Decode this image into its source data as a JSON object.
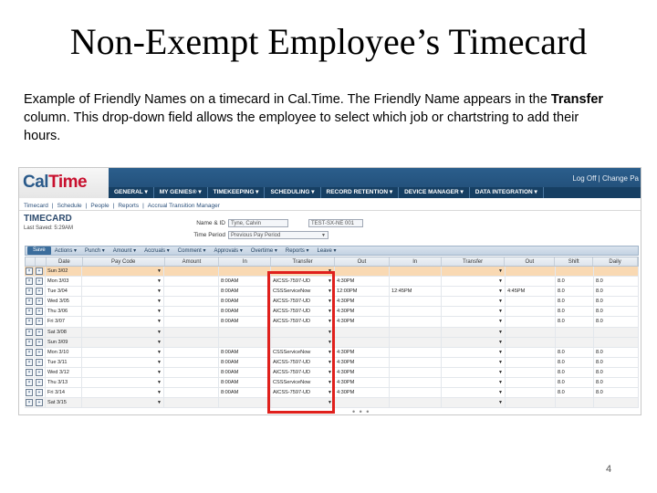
{
  "slide": {
    "title": "Non-Exempt Employee’s Timecard",
    "body_part1": "Example of Friendly Names on a timecard in Cal.Time.  The Friendly Name appears in the ",
    "body_bold": "Transfer",
    "body_part2": " column.  This drop-down field allows the employee to select which job or chartstring to add their hours.",
    "page_number": "4"
  },
  "app": {
    "logo_part1": "Cal",
    "logo_part2": "Time",
    "header_links": "Log Off | Change Pa",
    "nav": [
      "GENERAL ▾",
      "MY GENIES® ▾",
      "TIMEKEEPING ▾",
      "SCHEDULING ▾",
      "RECORD RETENTION ▾",
      "DEVICE MANAGER ▾",
      "DATA INTEGRATION ▾"
    ],
    "subnav": [
      "Timecard",
      "|",
      "Schedule",
      "|",
      "People",
      "|",
      "Reports",
      "|",
      "Accrual Transition Manager"
    ]
  },
  "timecard": {
    "title": "TIMECARD",
    "last_saved": "Last Saved: 5:29AM",
    "name_label": "Name & ID",
    "name_value": "Tyne, Calvin",
    "id_value": "TEST-SX-NE 001",
    "period_label": "Time Period",
    "period_value": "Previous Pay Period"
  },
  "toolbar": {
    "save": "Save",
    "items": [
      "Actions ▾",
      "Punch ▾",
      "Amount ▾",
      "Accruals ▾",
      "Comment ▾",
      "Approvals ▾",
      "Overtime ▾",
      "Reports ▾",
      "Leave ▾"
    ]
  },
  "grid": {
    "columns": [
      "",
      "",
      "Date",
      "Pay Code",
      "Amount",
      "In",
      "Transfer",
      "Out",
      "In",
      "Transfer",
      "Out",
      "Shift",
      "Daily"
    ],
    "rows": [
      {
        "date": "Sun 3/02",
        "in": "",
        "transfer": "",
        "out": "",
        "in2": "",
        "out2": "",
        "shift": "",
        "daily": "",
        "style": "selected"
      },
      {
        "date": "Mon 3/03",
        "in": "8:00AM",
        "transfer": "AICSS-7597-UD",
        "out": "4:30PM",
        "in2": "",
        "out2": "",
        "shift": "8.0",
        "daily": "8.0",
        "style": ""
      },
      {
        "date": "Tue 3/04",
        "in": "8:00AM",
        "transfer": "CSSServiceNow",
        "out": "12:00PM",
        "in2": "12:45PM",
        "out2": "4:45PM",
        "shift": "8.0",
        "daily": "8.0",
        "style": ""
      },
      {
        "date": "Wed 3/05",
        "in": "8:00AM",
        "transfer": "AICSS-7597-UD",
        "out": "4:30PM",
        "in2": "",
        "out2": "",
        "shift": "8.0",
        "daily": "8.0",
        "style": ""
      },
      {
        "date": "Thu 3/06",
        "in": "8:00AM",
        "transfer": "AICSS-7597-UD",
        "out": "4:30PM",
        "in2": "",
        "out2": "",
        "shift": "8.0",
        "daily": "8.0",
        "style": ""
      },
      {
        "date": "Fri 3/07",
        "in": "8:00AM",
        "transfer": "AICSS-7597-UD",
        "out": "4:30PM",
        "in2": "",
        "out2": "",
        "shift": "8.0",
        "daily": "8.0",
        "style": ""
      },
      {
        "date": "Sat 3/08",
        "in": "",
        "transfer": "",
        "out": "",
        "in2": "",
        "out2": "",
        "shift": "",
        "daily": "",
        "style": "weekend"
      },
      {
        "date": "Sun 3/09",
        "in": "",
        "transfer": "",
        "out": "",
        "in2": "",
        "out2": "",
        "shift": "",
        "daily": "",
        "style": "weekend"
      },
      {
        "date": "Mon 3/10",
        "in": "8:00AM",
        "transfer": "CSSServiceNow",
        "out": "4:30PM",
        "in2": "",
        "out2": "",
        "shift": "8.0",
        "daily": "8.0",
        "style": ""
      },
      {
        "date": "Tue 3/11",
        "in": "8:00AM",
        "transfer": "AICSS-7597-UD",
        "out": "4:30PM",
        "in2": "",
        "out2": "",
        "shift": "8.0",
        "daily": "8.0",
        "style": ""
      },
      {
        "date": "Wed 3/12",
        "in": "8:00AM",
        "transfer": "AICSS-7597-UD",
        "out": "4:30PM",
        "in2": "",
        "out2": "",
        "shift": "8.0",
        "daily": "8.0",
        "style": ""
      },
      {
        "date": "Thu 3/13",
        "in": "8:00AM",
        "transfer": "CSSServiceNow",
        "out": "4:30PM",
        "in2": "",
        "out2": "",
        "shift": "8.0",
        "daily": "8.0",
        "style": ""
      },
      {
        "date": "Fri 3/14",
        "in": "8:00AM",
        "transfer": "AICSS-7597-UD",
        "out": "4:30PM",
        "in2": "",
        "out2": "",
        "shift": "8.0",
        "daily": "8.0",
        "style": ""
      },
      {
        "date": "Sat 3/15",
        "in": "",
        "transfer": "",
        "out": "",
        "in2": "",
        "out2": "",
        "shift": "",
        "daily": "",
        "style": "weekend"
      }
    ]
  },
  "colors": {
    "highlight": "#e0201c",
    "header": "#1f4a73",
    "selected_row": "#f9d9b3"
  },
  "icons": {
    "delete": "delete-row-icon",
    "add": "add-row-icon",
    "dropdown": "chevron-down-icon"
  }
}
